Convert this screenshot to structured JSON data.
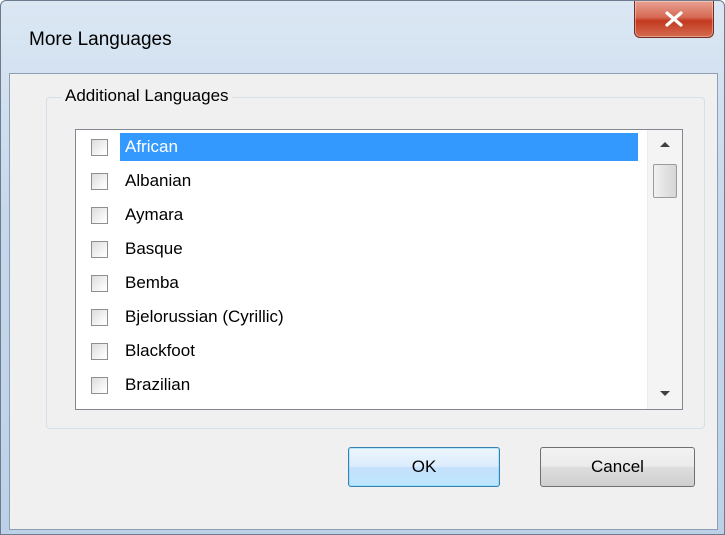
{
  "window": {
    "title": "More Languages"
  },
  "group": {
    "label": "Additional Languages"
  },
  "languages": [
    {
      "label": "African",
      "checked": false,
      "selected": true
    },
    {
      "label": "Albanian",
      "checked": false,
      "selected": false
    },
    {
      "label": "Aymara",
      "checked": false,
      "selected": false
    },
    {
      "label": "Basque",
      "checked": false,
      "selected": false
    },
    {
      "label": "Bemba",
      "checked": false,
      "selected": false
    },
    {
      "label": "Bjelorussian (Cyrillic)",
      "checked": false,
      "selected": false
    },
    {
      "label": "Blackfoot",
      "checked": false,
      "selected": false
    },
    {
      "label": "Brazilian",
      "checked": false,
      "selected": false
    }
  ],
  "buttons": {
    "ok": "OK",
    "cancel": "Cancel"
  },
  "colors": {
    "selection": "#3399ff",
    "close_button": "#c2391f",
    "title_bar": "#c6d8ec"
  },
  "icons": {
    "close": "close-icon",
    "scroll_up": "scroll-up-arrow-icon",
    "scroll_down": "scroll-down-arrow-icon"
  }
}
